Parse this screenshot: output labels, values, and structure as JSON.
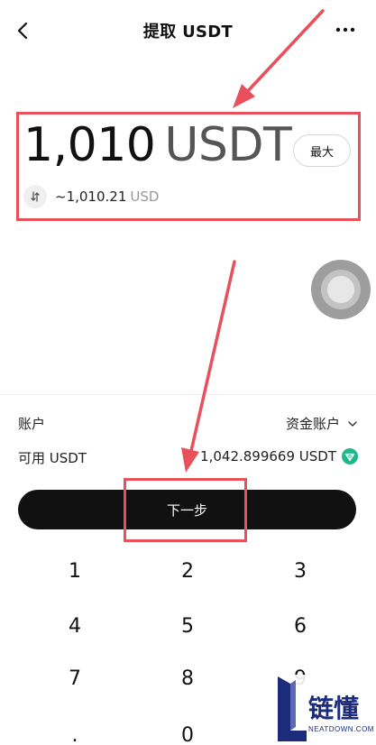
{
  "header": {
    "title": "提取 USDT"
  },
  "amount": {
    "value": "1,010",
    "currency": "USDT",
    "max_label": "最大"
  },
  "fiat": {
    "value": "~1,010.21",
    "currency": "USD"
  },
  "account": {
    "label": "账户",
    "value": "资金账户"
  },
  "available": {
    "label": "可用 USDT",
    "value": "1,042.899669 USDT"
  },
  "next_button": {
    "label": "下一步"
  },
  "keypad": {
    "keys": [
      "1",
      "2",
      "3",
      "4",
      "5",
      "6",
      "7",
      "8",
      "9",
      ".",
      "0"
    ]
  },
  "watermark": {
    "brand": "链懂",
    "site": "NEATDOWN.COM"
  },
  "colors": {
    "annotation": "#e8505b",
    "primary": "#111111",
    "muted": "#999999",
    "tron_gem": "#1fb88a",
    "watermark": "#1c2b7a"
  },
  "icons": {
    "back": "chevron-left-icon",
    "more": "more-dots-icon",
    "swap": "swap-arrows-icon",
    "account_dropdown": "chevron-down-icon",
    "network": "gem-icon"
  }
}
